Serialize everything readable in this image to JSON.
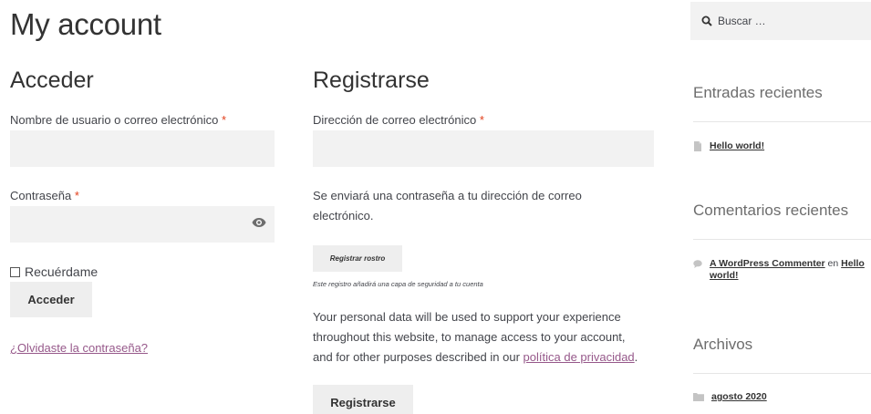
{
  "page": {
    "title": "My account"
  },
  "login": {
    "heading": "Acceder",
    "username_label": "Nombre de usuario o correo electrónico",
    "required_mark": "*",
    "username_value": "",
    "password_label": "Contraseña",
    "password_value": "",
    "remember_label": "Recuérdame",
    "submit_label": "Acceder",
    "lost_password_link": "¿Olvidaste la contraseña?"
  },
  "register": {
    "heading": "Registrarse",
    "email_label": "Dirección de correo electrónico",
    "required_mark": "*",
    "email_value": "",
    "password_note_line1": "Se enviará una contraseña a tu dirección de correo",
    "password_note_line2": "electrónico.",
    "face_button_label": "Registrar rostro",
    "face_note": "Este registro añadirá una capa de seguridad a tu cuenta",
    "privacy_line1": "Your personal data will be used to support your experience",
    "privacy_line2": "throughout this website, to manage access to your account,",
    "privacy_line3_prefix": "and for other purposes described in our ",
    "privacy_link": "política de privacidad",
    "privacy_line3_suffix": ".",
    "submit_label": "Registrarse"
  },
  "sidebar": {
    "search_placeholder": "Buscar …",
    "recent_posts_heading": "Entradas recientes",
    "recent_posts": [
      {
        "title": "Hello world!",
        "icon": "document-icon"
      }
    ],
    "recent_comments_heading": "Comentarios recientes",
    "recent_comments": [
      {
        "author": "A WordPress Commenter",
        "connector": "en",
        "post_line1": "Hello",
        "post_line2": "world!",
        "icon": "speech-bubble-icon"
      }
    ],
    "archives_heading": "Archivos",
    "archives": [
      {
        "label": "agosto 2020",
        "icon": "folder-icon"
      }
    ]
  },
  "colors": {
    "accent_link": "#96588a",
    "required": "#e2401c",
    "field_bg": "#f2f2f2",
    "button_bg": "#eeeeee"
  }
}
